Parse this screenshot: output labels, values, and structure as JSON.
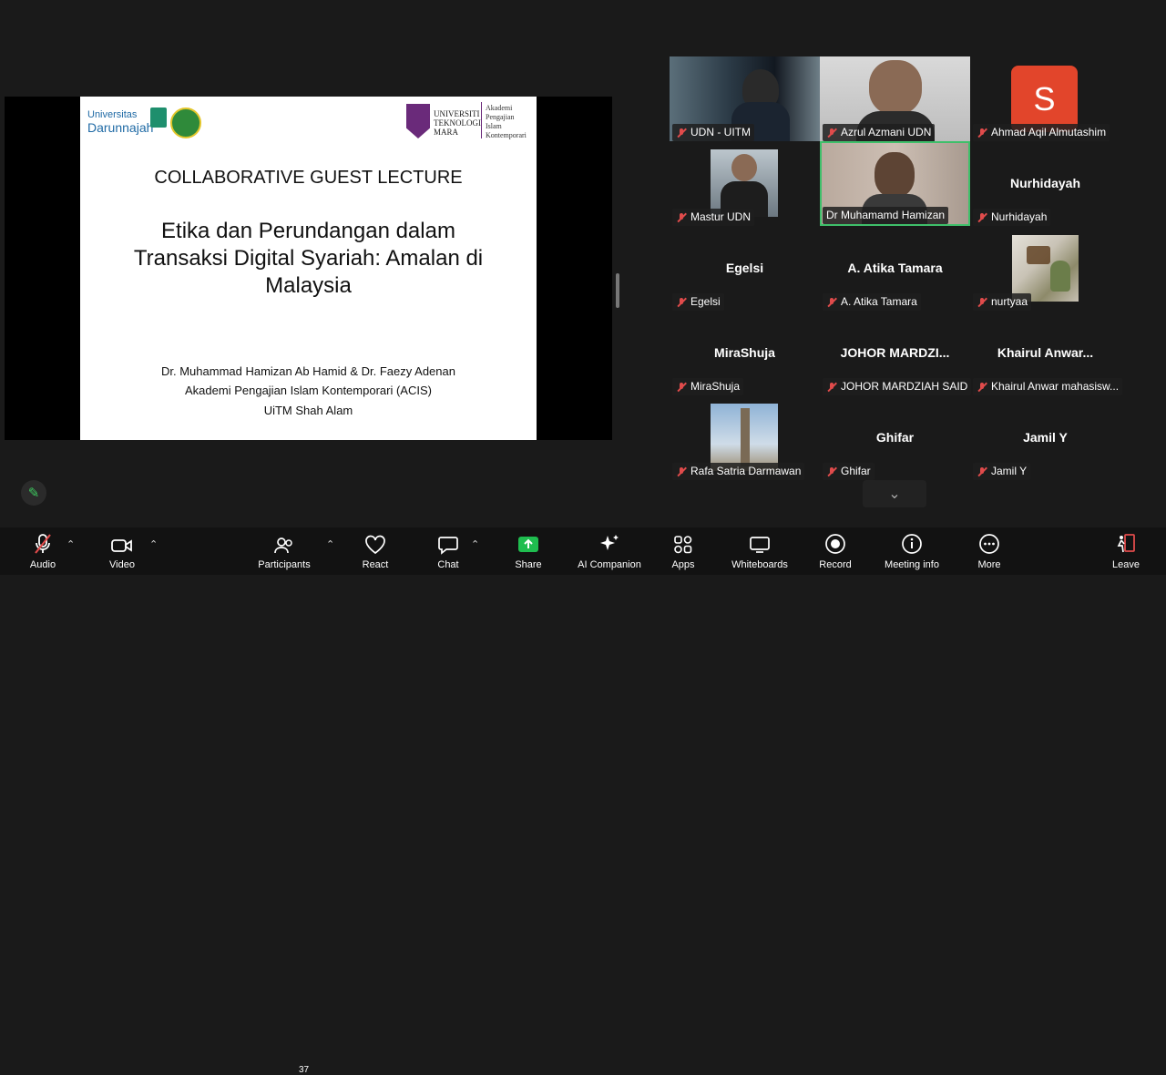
{
  "slide": {
    "logo_left_line1": "Universitas",
    "logo_left_line2": "Darunnajah",
    "logo_right_lines": [
      "UNIVERSITI",
      "TEKNOLOGI",
      "MARA"
    ],
    "logo_right_academy": [
      "Akademi",
      "Pengajian Islam",
      "Kontemporari"
    ],
    "heading": "COLLABORATIVE GUEST LECTURE",
    "title": "Etika dan Perundangan dalam Transaksi Digital Syariah: Amalan di Malaysia",
    "authors": "Dr. Muhammad Hamizan Ab Hamid & Dr. Faezy Adenan",
    "affiliation": "Akademi Pengajian Islam Kontemporari (ACIS)",
    "location": "UiTM Shah Alam"
  },
  "participants": [
    {
      "label": "UDN - UITM",
      "display": "video"
    },
    {
      "label": "Azrul Azmani UDN",
      "display": "video"
    },
    {
      "label": "Ahmad Aqil Almutashim",
      "display": "avatar",
      "avatar_letter": "S",
      "avatar_color": "#e2452b"
    },
    {
      "label": "Mastur UDN",
      "display": "photo"
    },
    {
      "label": "Dr Muhamamd Hamizan",
      "display": "video",
      "active_speaker": true
    },
    {
      "label": "Nurhidayah",
      "display": "name",
      "big_name": "Nurhidayah"
    },
    {
      "label": "Egelsi",
      "display": "name",
      "big_name": "Egelsi"
    },
    {
      "label": "A. Atika Tamara",
      "display": "name",
      "big_name": "A. Atika Tamara"
    },
    {
      "label": "nurtyaa",
      "display": "photo"
    },
    {
      "label": "MiraShuja",
      "display": "name",
      "big_name": "MiraShuja"
    },
    {
      "label": "JOHOR MARDZIAH SAID",
      "display": "name",
      "big_name": "JOHOR  MARDZI..."
    },
    {
      "label": "Khairul Anwar mahasisw...",
      "display": "name",
      "big_name": "Khairul  Anwar..."
    },
    {
      "label": "Rafa Satria Darmawan",
      "display": "photo"
    },
    {
      "label": "Ghifar",
      "display": "name",
      "big_name": "Ghifar"
    },
    {
      "label": "Jamil Y",
      "display": "name",
      "big_name": "Jamil Y"
    }
  ],
  "toolbar": {
    "audio": "Audio",
    "video": "Video",
    "participants": "Participants",
    "participants_count": "37",
    "react": "React",
    "chat": "Chat",
    "share": "Share",
    "ai_companion": "AI Companion",
    "apps": "Apps",
    "whiteboards": "Whiteboards",
    "record": "Record",
    "meeting_info": "Meeting info",
    "more": "More",
    "leave": "Leave",
    "share_color": "#1fbd4f",
    "leave_color": "#e04b4b"
  }
}
